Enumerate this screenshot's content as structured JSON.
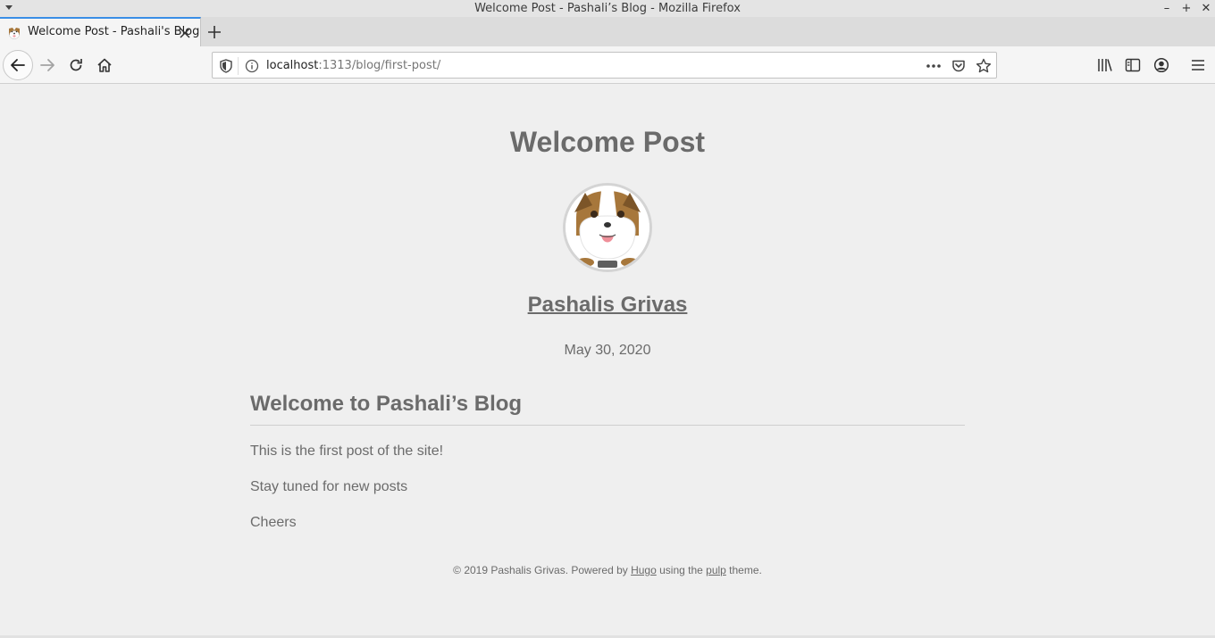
{
  "window": {
    "title": "Welcome Post - Pashali’s Blog - Mozilla Firefox"
  },
  "tab": {
    "title": "Welcome Post - Pashali's Blog"
  },
  "navbar": {
    "url_host": "localhost",
    "url_rest": ":1313/blog/first-post/"
  },
  "post": {
    "title": "Welcome Post",
    "author": "Pashalis Grivas",
    "date": "May 30, 2020",
    "heading": "Welcome to Pashali’s Blog",
    "paragraphs": [
      "This is the first post of the site!",
      "Stay tuned for new posts",
      "Cheers"
    ]
  },
  "footer": {
    "prefix": "© 2019 Pashalis Grivas. Powered by ",
    "hugo": "Hugo",
    "middle": " using the ",
    "pulp": "pulp",
    "suffix": " theme."
  },
  "colors": {
    "page_bg": "#efefef",
    "text": "#6b6b6b",
    "tab_accent": "#3a8ee6"
  }
}
